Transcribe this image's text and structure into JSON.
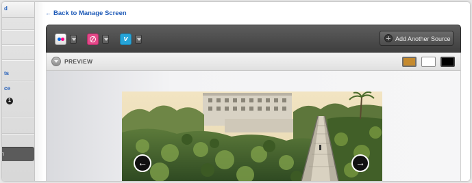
{
  "sidebar": {
    "top_text": "d",
    "text_1": "ts",
    "text_2": "ce",
    "badge": "1",
    "active_item": "n"
  },
  "back_link": {
    "label": "Back to Manage Screen"
  },
  "toolbar": {
    "sources": [
      {
        "name": "flickr-icon"
      },
      {
        "name": "dribbble-icon"
      },
      {
        "name": "vimeo-icon",
        "glyph": "v"
      }
    ],
    "add_source_label": "Add Another Source"
  },
  "preview": {
    "label": "PREVIEW",
    "swatches": [
      {
        "name": "gold",
        "color": "#c58a2e",
        "selected": true
      },
      {
        "name": "white",
        "color": "#ffffff",
        "selected": false
      },
      {
        "name": "black",
        "color": "#000000",
        "selected": false
      }
    ]
  },
  "slideshow": {
    "prev_glyph": "←",
    "next_glyph": "→"
  }
}
